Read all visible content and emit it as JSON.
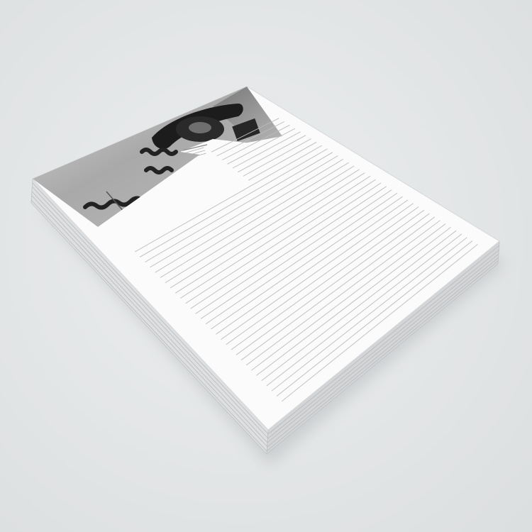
{
  "scene": {
    "subject": "notepad-stack",
    "background_color": "#e4e6e7",
    "paper_color": "#fbfbfb",
    "rule_color": "#b9bcc0",
    "ruled_line_count": 38,
    "sheet_count": 6,
    "header_text_lines": 4
  }
}
